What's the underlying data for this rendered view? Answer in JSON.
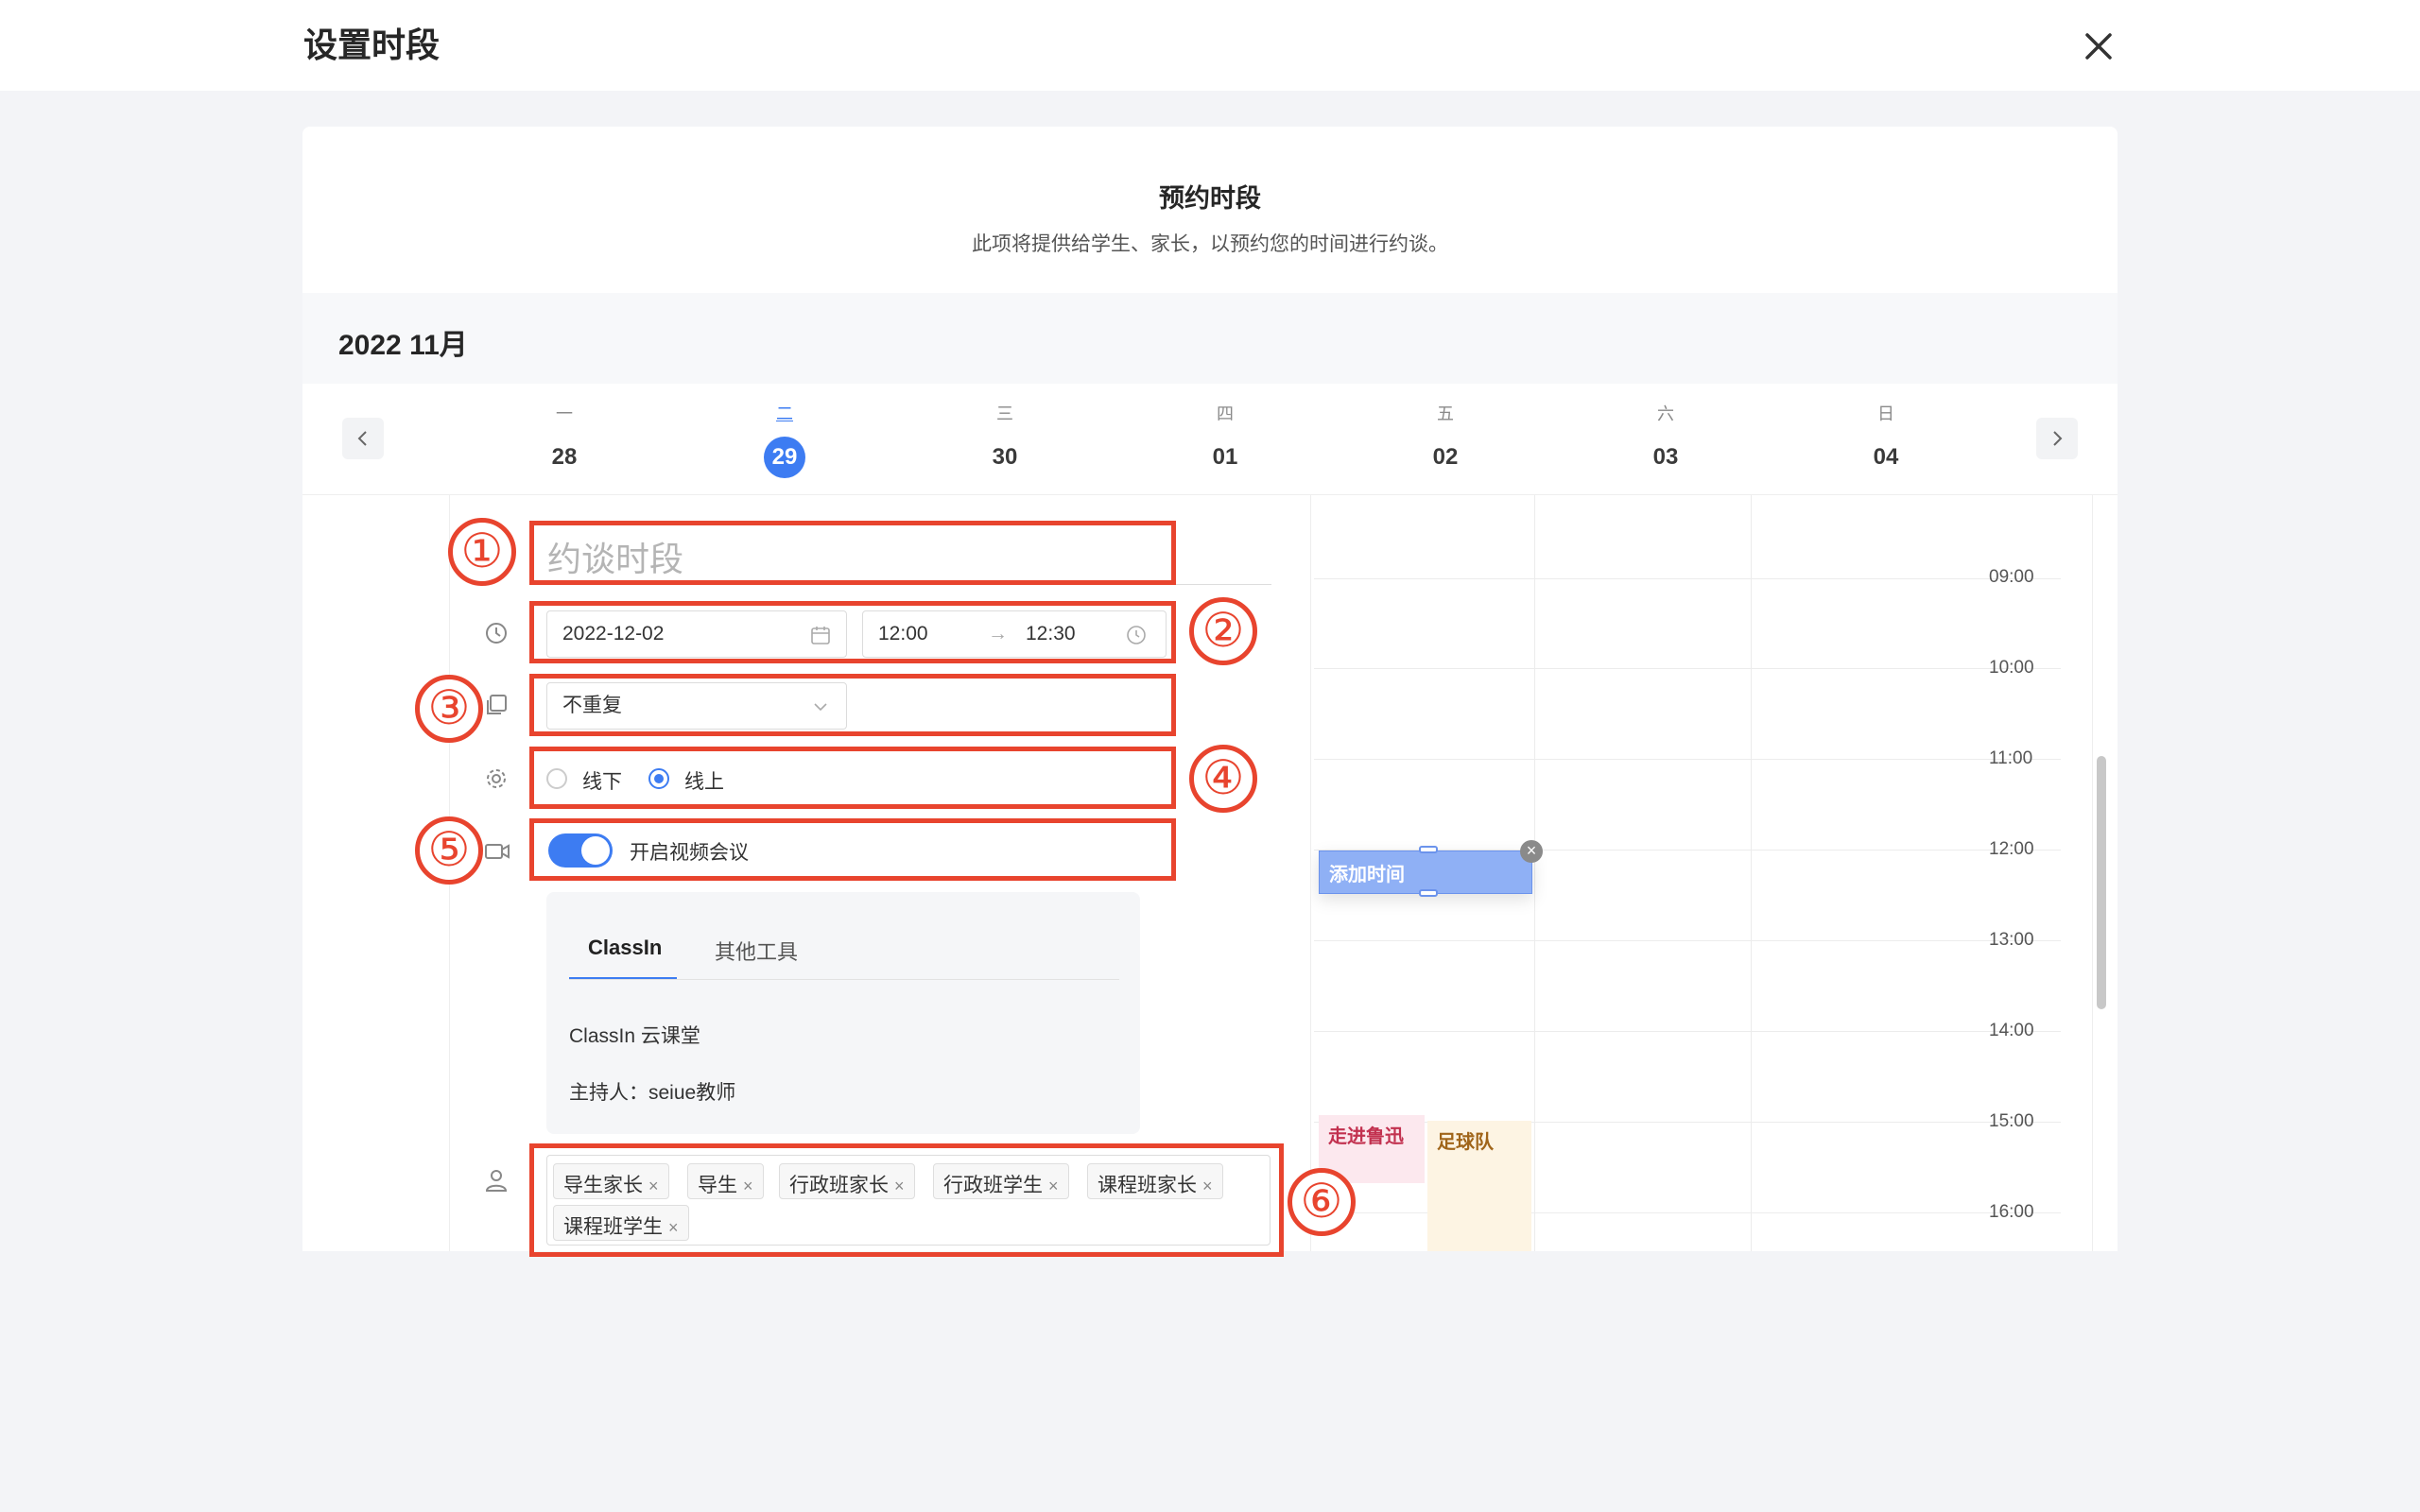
{
  "dialog": {
    "title": "设置时段"
  },
  "header": {
    "heading": "预约时段",
    "subtitle": "此项将提供给学生、家长，以预约您的时间进行约谈。"
  },
  "month": "2022 11月",
  "week": [
    {
      "weekday": "一",
      "date": "28"
    },
    {
      "weekday": "二",
      "date": "29"
    },
    {
      "weekday": "三",
      "date": "30"
    },
    {
      "weekday": "四",
      "date": "01"
    },
    {
      "weekday": "五",
      "date": "02"
    },
    {
      "weekday": "六",
      "date": "03"
    },
    {
      "weekday": "日",
      "date": "04"
    }
  ],
  "times": [
    "09:00",
    "10:00",
    "11:00",
    "12:00",
    "13:00",
    "14:00",
    "15:00",
    "16:00"
  ],
  "form": {
    "title_placeholder": "约谈时段",
    "date": "2022-12-02",
    "start_time": "12:00",
    "end_time": "12:30",
    "arrow": "→",
    "repeat": "不重复",
    "mode_offline": "线下",
    "mode_online": "线上",
    "video_label": "开启视频会议",
    "video_enabled": true,
    "tabs": [
      "ClassIn",
      "其他工具"
    ],
    "tool_name": "ClassIn 云课堂",
    "host": "主持人：seiue教师",
    "tags": [
      "导生家长",
      "导生",
      "行政班家长",
      "行政班学生",
      "课程班家长",
      "课程班学生"
    ]
  },
  "events": {
    "add": "添加时间",
    "e1": "走进鲁迅",
    "e2": "足球队"
  },
  "annotations": [
    "①",
    "②",
    "③",
    "④",
    "⑤",
    "⑥"
  ],
  "colors": {
    "accent": "#3d7cf2",
    "annotation": "#e8442e",
    "event_pink": "#fce8ee",
    "event_yellow": "#fdf4e3"
  }
}
